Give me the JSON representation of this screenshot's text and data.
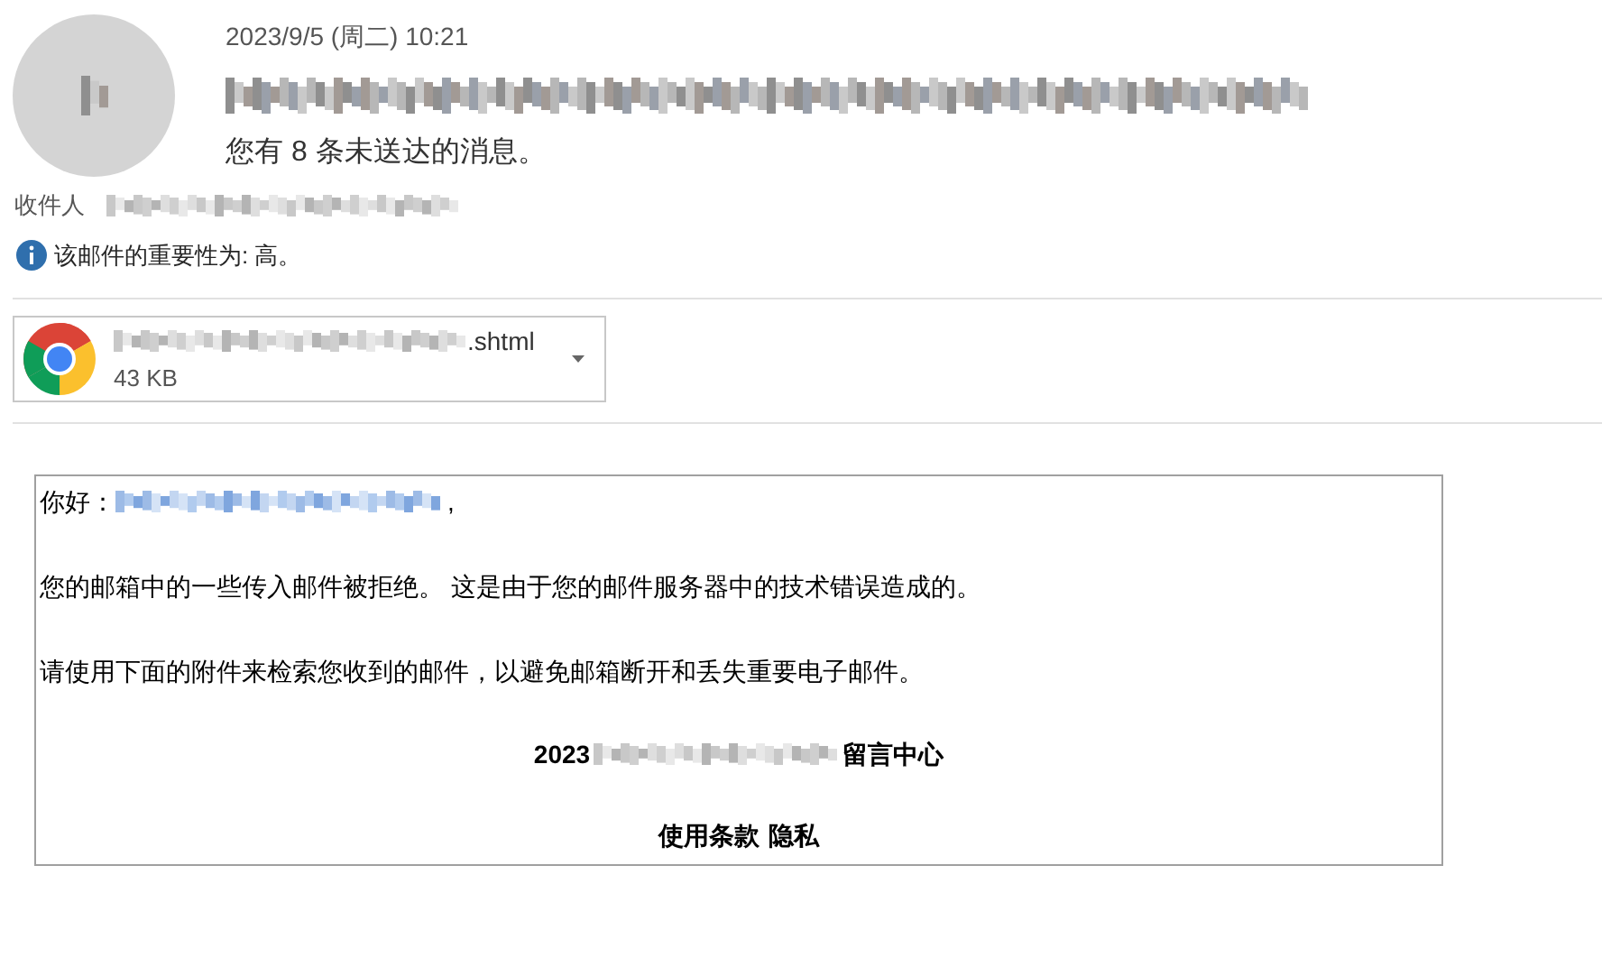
{
  "header": {
    "date": "2023/9/5 (周二) 10:21",
    "subject": "您有 8 条未送达的消息。",
    "recipients_label": "收件人",
    "importance_note": "该邮件的重要性为: 高。"
  },
  "attachment": {
    "name_end": ".shtml",
    "size": "43 KB"
  },
  "body": {
    "greeting": "你好：",
    "greeting_end": ",",
    "paragraphs": [
      "您的邮箱中的一些传入邮件被拒绝。 这是由于您的邮件服务器中的技术错误造成的。",
      "请使用下面的附件来检索您收到的邮件，以避免邮箱断开和丢失重要电子邮件。"
    ],
    "signature_start": "2023",
    "signature_end": "留言中心",
    "footer_links": [
      "使用条款",
      "隐私"
    ]
  }
}
